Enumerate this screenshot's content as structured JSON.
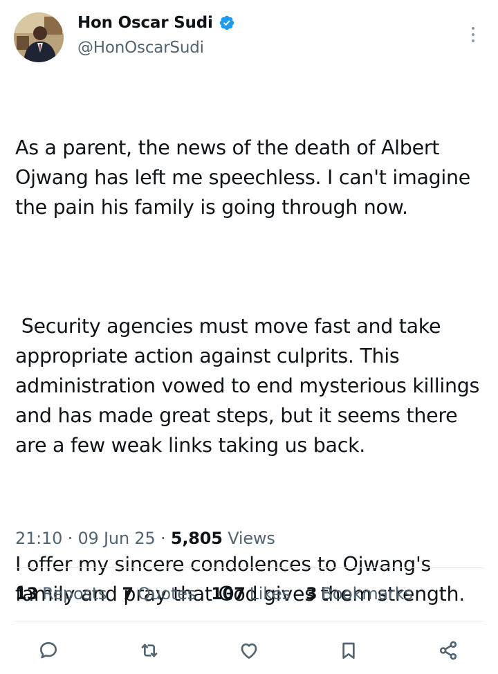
{
  "author": {
    "name": "Hon Oscar Sudi",
    "handle": "@HonOscarSudi",
    "verified": true,
    "avatar_icon": "profile-photo"
  },
  "tweet": {
    "paragraphs": [
      "As a parent, the news of the death of Albert Ojwang has left me speechless. I can't imagine the pain his family is going through now.",
      " Security agencies must move fast and take appropriate action against culprits. This administration vowed to end mysterious killings and has made great steps, but it seems there are a few weak links taking us back.",
      "I offer my sincere condolences to Ojwang's family and pray that God gives them strength."
    ],
    "time": "21:10",
    "separator": "·",
    "date": "09 Jun 25",
    "views_count": "5,805",
    "views_label": "Views"
  },
  "stats": [
    {
      "count": "13",
      "label": "Reposts"
    },
    {
      "count": "7",
      "label": "Quotes"
    },
    {
      "count": "107",
      "label": "Likes"
    },
    {
      "count": "3",
      "label": "Bookmarks"
    }
  ],
  "actions": [
    "reply-icon",
    "repost-icon",
    "like-icon",
    "bookmark-icon",
    "share-icon"
  ],
  "colors": {
    "text": "#0f1419",
    "secondary": "#536471",
    "verified": "#1d9bf0",
    "divider": "#e6e9ec",
    "icon": "#536471"
  }
}
